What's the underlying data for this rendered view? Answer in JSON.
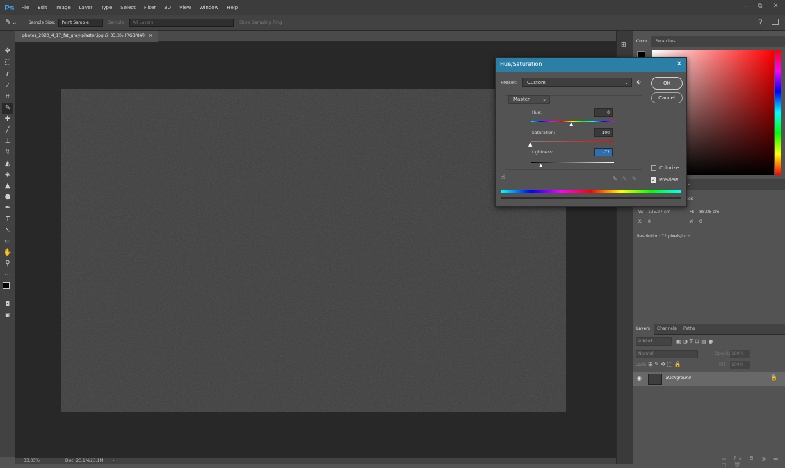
{
  "app": {
    "logo": "Ps",
    "menu": [
      "File",
      "Edit",
      "Image",
      "Layer",
      "Type",
      "Select",
      "Filter",
      "3D",
      "View",
      "Window",
      "Help"
    ],
    "window_controls": [
      "–",
      "⧉",
      "✕"
    ]
  },
  "options_bar": {
    "sample_size_label": "Sample Size:",
    "sample_size_value": "Point Sample",
    "sample_label": "Sample:",
    "sample_value": "All Layers",
    "show_ring_label": "Show Sampling Ring"
  },
  "document": {
    "tab_title": "photos_2020_4_17_fst_gray-plaster.jpg @ 33.3% (RGB/8#)",
    "tab_close": "×",
    "image_color": "#3d3d3d"
  },
  "status": {
    "zoom": "33.33%",
    "doc_info": "Doc: 23.1M/23.1M"
  },
  "color_panel": {
    "tabs": [
      "Color",
      "Swatches"
    ]
  },
  "properties_panel": {
    "title_fragment": "ties",
    "w_label": "W:",
    "w_value": "125.27 cm",
    "h_label": "H:",
    "h_value": "88.05 cm",
    "x_label": "X:",
    "x_value": "0",
    "y_label": "Y:",
    "y_value": "0",
    "resolution": "Resolution: 72 pixels/inch"
  },
  "layers_panel": {
    "tabs": [
      "Layers",
      "Channels",
      "Paths"
    ],
    "kind_label": "Kind",
    "blend_mode": "Normal",
    "opacity_label": "Opacity:",
    "opacity_value": "100%",
    "lock_label": "Lock:",
    "fill_label": "Fill:",
    "fill_value": "100%",
    "layer_name": "Background"
  },
  "dialog": {
    "title": "Hue/Saturation",
    "close": "✕",
    "preset_label": "Preset:",
    "preset_value": "Custom",
    "channel": "Master",
    "hue_label": "Hue:",
    "hue_value": "0",
    "saturation_label": "Saturation:",
    "saturation_value": "-100",
    "lightness_label": "Lightness:",
    "lightness_value": "-72",
    "ok_label": "OK",
    "cancel_label": "Cancel",
    "colorize_label": "Colorize",
    "colorize_checked": false,
    "preview_label": "Preview",
    "preview_checked": true,
    "title_bar_color": "#2b7ea6"
  }
}
